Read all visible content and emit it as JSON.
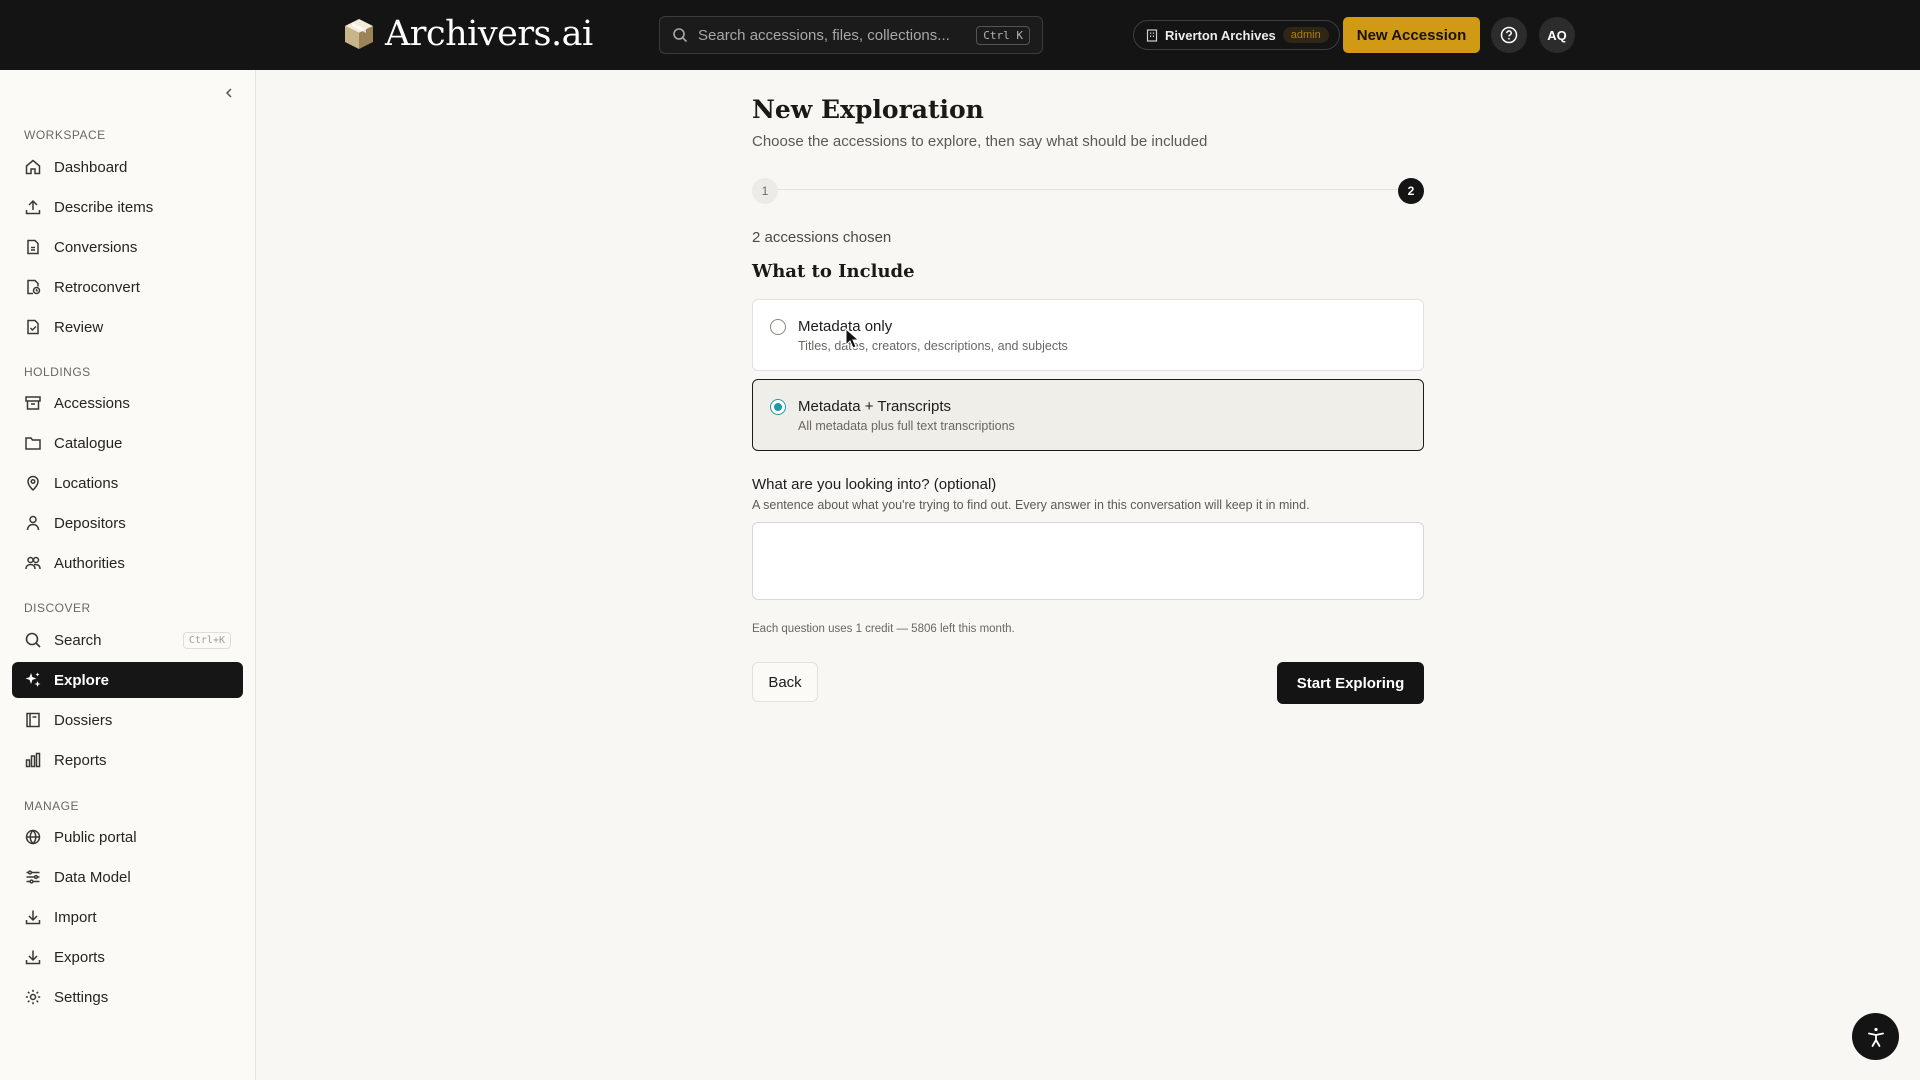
{
  "header": {
    "brand": "Archivers.ai",
    "search_placeholder": "Search accessions, files, collections...",
    "search_shortcut": "Ctrl K",
    "org_name": "Riverton Archives",
    "org_role": "admin",
    "new_accession_label": "New Accession",
    "avatar_initials": "AQ"
  },
  "sidebar": {
    "sections": {
      "workspace": "WORKSPACE",
      "holdings": "HOLDINGS",
      "discover": "DISCOVER",
      "manage": "MANAGE"
    },
    "items": [
      {
        "label": "Dashboard",
        "icon": "home-icon"
      },
      {
        "label": "Describe items",
        "icon": "upload-icon"
      },
      {
        "label": "Conversions",
        "icon": "file-convert-icon"
      },
      {
        "label": "Retroconvert",
        "icon": "file-history-icon"
      },
      {
        "label": "Review",
        "icon": "file-check-icon"
      },
      {
        "label": "Accessions",
        "icon": "archive-box-icon"
      },
      {
        "label": "Catalogue",
        "icon": "folder-icon"
      },
      {
        "label": "Locations",
        "icon": "map-pin-icon"
      },
      {
        "label": "Depositors",
        "icon": "user-icon"
      },
      {
        "label": "Authorities",
        "icon": "users-icon"
      },
      {
        "label": "Search",
        "icon": "search-icon",
        "shortcut": "Ctrl+K"
      },
      {
        "label": "Explore",
        "icon": "sparkles-icon",
        "active": true
      },
      {
        "label": "Dossiers",
        "icon": "book-icon"
      },
      {
        "label": "Reports",
        "icon": "bar-chart-icon"
      },
      {
        "label": "Public portal",
        "icon": "globe-icon"
      },
      {
        "label": "Data Model",
        "icon": "sliders-icon"
      },
      {
        "label": "Import",
        "icon": "download-icon"
      },
      {
        "label": "Exports",
        "icon": "export-icon"
      },
      {
        "label": "Settings",
        "icon": "gear-icon"
      }
    ]
  },
  "main": {
    "title": "New Exploration",
    "subtitle": "Choose the accessions to explore, then say what should be included",
    "steps": [
      "1",
      "2"
    ],
    "current_step": 2,
    "chosen": "2 accessions chosen",
    "include_heading": "What to Include",
    "options": [
      {
        "label": "Metadata only",
        "desc": "Titles, dates, creators, descriptions, and subjects",
        "selected": false
      },
      {
        "label": "Metadata + Transcripts",
        "desc": "All metadata plus full text transcriptions",
        "selected": true
      }
    ],
    "question_label": "What are you looking into? (optional)",
    "question_help": "A sentence about what you're trying to find out. Every answer in this conversation will keep it in mind.",
    "question_value": "",
    "credits_note": "Each question uses 1 credit — 5806 left this month.",
    "back_label": "Back",
    "start_label": "Start Exploring"
  },
  "colors": {
    "topbar_bg": "#141414",
    "accent": "#d19a14",
    "radio_accent": "#1e9aa6",
    "active_nav_bg": "#161616"
  }
}
